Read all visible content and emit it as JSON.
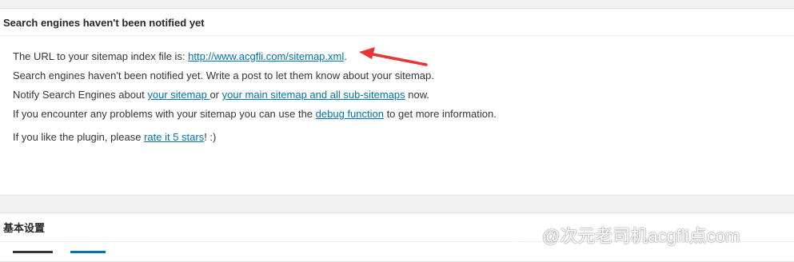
{
  "status_panel": {
    "title": "Search engines haven't been notified yet",
    "line1_prefix": "The URL to your sitemap index file is: ",
    "sitemap_url": "http://www.acgfli.com/sitemap.xml",
    "line1_suffix": ".",
    "line2": "Search engines haven't been notified yet. Write a post to let them know about your sitemap.",
    "line3_prefix": "Notify Search Engines about ",
    "your_sitemap_link": "your sitemap ",
    "line3_or": " or ",
    "main_sitemap_link": "your main sitemap and all sub-sitemaps",
    "line3_suffix": " now.",
    "line4_prefix": "If you encounter any problems with your sitemap you can use the ",
    "debug_link": "debug function",
    "line4_suffix": " to get more information.",
    "line5_prefix": "If you like the plugin, please ",
    "rate_link": "rate it 5 stars",
    "line5_suffix": "! :)"
  },
  "basic_panel": {
    "title": "基本设置"
  },
  "watermark": {
    "text": "@次元老司机acgfli点com",
    "icon": "weibo-icon"
  },
  "colors": {
    "link": "#0073aa",
    "arrow": "#e8362f",
    "background": "#f1f1f1"
  }
}
